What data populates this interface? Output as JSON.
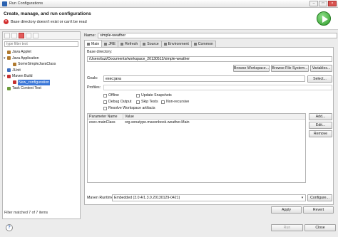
{
  "window": {
    "title": "Run Configurations"
  },
  "header": {
    "title": "Create, manage, and run configurations",
    "message": "Base directory doesn't exist or can't be read"
  },
  "sidebar": {
    "filter_placeholder": "type filter text",
    "items": [
      {
        "label": "Java Applet",
        "icon": "java-applet-icon",
        "level": 0
      },
      {
        "label": "Java Application",
        "icon": "java-app-icon",
        "level": 0,
        "expanded": true
      },
      {
        "label": "SomeSimpleJavaClass",
        "icon": "java-class-icon",
        "level": 1
      },
      {
        "label": "JUnit",
        "icon": "junit-icon",
        "level": 0
      },
      {
        "label": "Maven Build",
        "icon": "maven-icon",
        "level": 0,
        "expanded": true
      },
      {
        "label": "New_configuration",
        "icon": "maven-config-icon",
        "level": 1,
        "selected": true
      },
      {
        "label": "Task Context Test",
        "icon": "task-icon",
        "level": 0
      }
    ],
    "status": "Filter matched 7 of 7 items"
  },
  "form": {
    "name_label": "Name:",
    "name_value": "simple-weather",
    "tabs": [
      "Main",
      "JRE",
      "Refresh",
      "Source",
      "Environment",
      "Common"
    ],
    "base_dir_label": "Base directory:",
    "base_dir_value": "/Users/tuzi/Documents/workspace_20130512/simple-weather",
    "browse_workspace": "Browse Workspace...",
    "browse_fs": "Browse File System...",
    "variables": "Variables...",
    "goals_label": "Goals:",
    "goals_value": "exec:java",
    "select": "Select...",
    "profiles_label": "Profiles:",
    "checks": {
      "offline": "Offline",
      "update_snapshots": "Update Snapshots",
      "debug_output": "Debug Output",
      "skip_tests": "Skip Tests",
      "non_recursive": "Non-recursive",
      "resolve_ws": "Resolve Workspace artifacts"
    },
    "params": {
      "headers": [
        "Parameter Name",
        "Value"
      ],
      "rows": [
        {
          "name": "exec.mainClass",
          "value": "org.sonatype.mavenbook.weather.Main"
        }
      ]
    },
    "add": "Add...",
    "edit": "Edit...",
    "remove": "Remove",
    "runtime_label": "Maven Runtime:",
    "runtime_value": "Embedded (3.0.4/1.3.0.20130129-0421)",
    "configure": "Configure...",
    "apply": "Apply",
    "revert": "Revert"
  },
  "footer": {
    "run": "Run",
    "close": "Close"
  }
}
